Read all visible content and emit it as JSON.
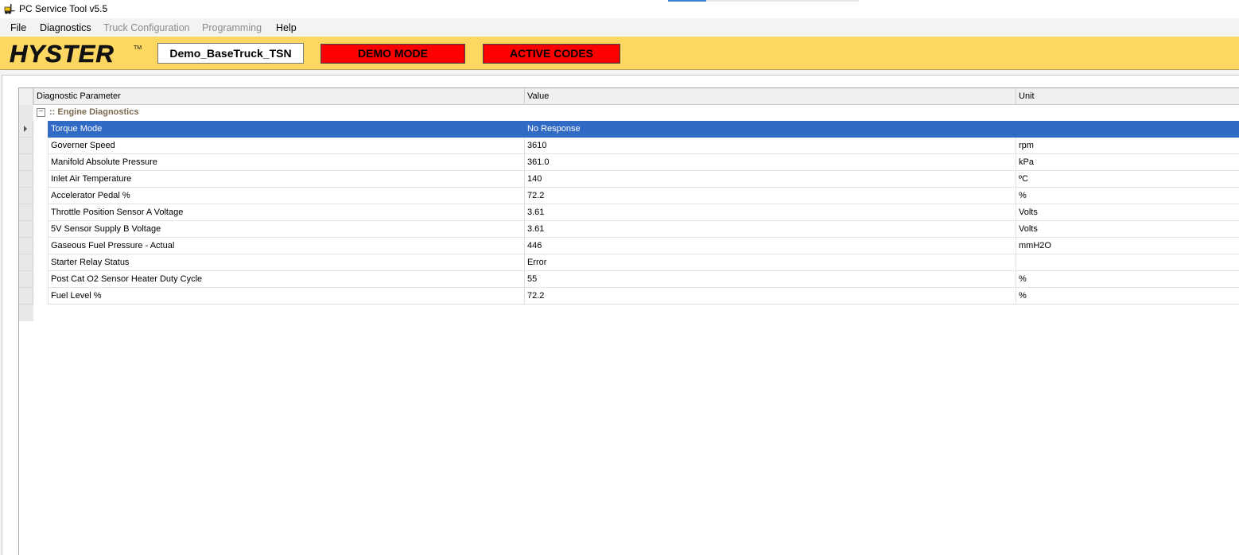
{
  "window": {
    "title": "PC Service Tool v5.5"
  },
  "menu": {
    "items": [
      {
        "label": "File",
        "enabled": true
      },
      {
        "label": "Diagnostics",
        "enabled": true
      },
      {
        "label": "Truck Configuration",
        "enabled": false
      },
      {
        "label": "Programming",
        "enabled": false
      },
      {
        "label": "Help",
        "enabled": true
      }
    ]
  },
  "brand": {
    "logo_text": "HYSTER",
    "logo_trademark": "TM",
    "truck_name": "Demo_BaseTruck_TSN",
    "demo_mode_label": "DEMO MODE",
    "active_codes_label": "ACTIVE CODES",
    "colors": {
      "bar": "#fcd862",
      "alert": "#ff0000",
      "selection": "#316ac5"
    }
  },
  "grid": {
    "columns": [
      "Diagnostic Parameter",
      "Value",
      "Unit"
    ],
    "group": {
      "collapse_symbol": "−",
      "label": ":: Engine Diagnostics"
    },
    "selected_row": 0,
    "rows": [
      {
        "param": "Torque Mode",
        "value": "No Response",
        "unit": ""
      },
      {
        "param": "Governer Speed",
        "value": "3610",
        "unit": "rpm"
      },
      {
        "param": "Manifold Absolute Pressure",
        "value": "361.0",
        "unit": "kPa"
      },
      {
        "param": "Inlet Air Temperature",
        "value": "140",
        "unit": "ºC"
      },
      {
        "param": "Accelerator Pedal %",
        "value": "72.2",
        "unit": "%"
      },
      {
        "param": "Throttle Position Sensor A Voltage",
        "value": "3.61",
        "unit": "Volts"
      },
      {
        "param": "5V Sensor Supply B Voltage",
        "value": "3.61",
        "unit": "Volts"
      },
      {
        "param": "Gaseous Fuel Pressure - Actual",
        "value": "446",
        "unit": "mmH2O"
      },
      {
        "param": "Starter Relay Status",
        "value": "Error",
        "unit": ""
      },
      {
        "param": "Post Cat O2 Sensor Heater Duty Cycle",
        "value": "55",
        "unit": "%"
      },
      {
        "param": "Fuel Level %",
        "value": "72.2",
        "unit": "%"
      }
    ]
  }
}
